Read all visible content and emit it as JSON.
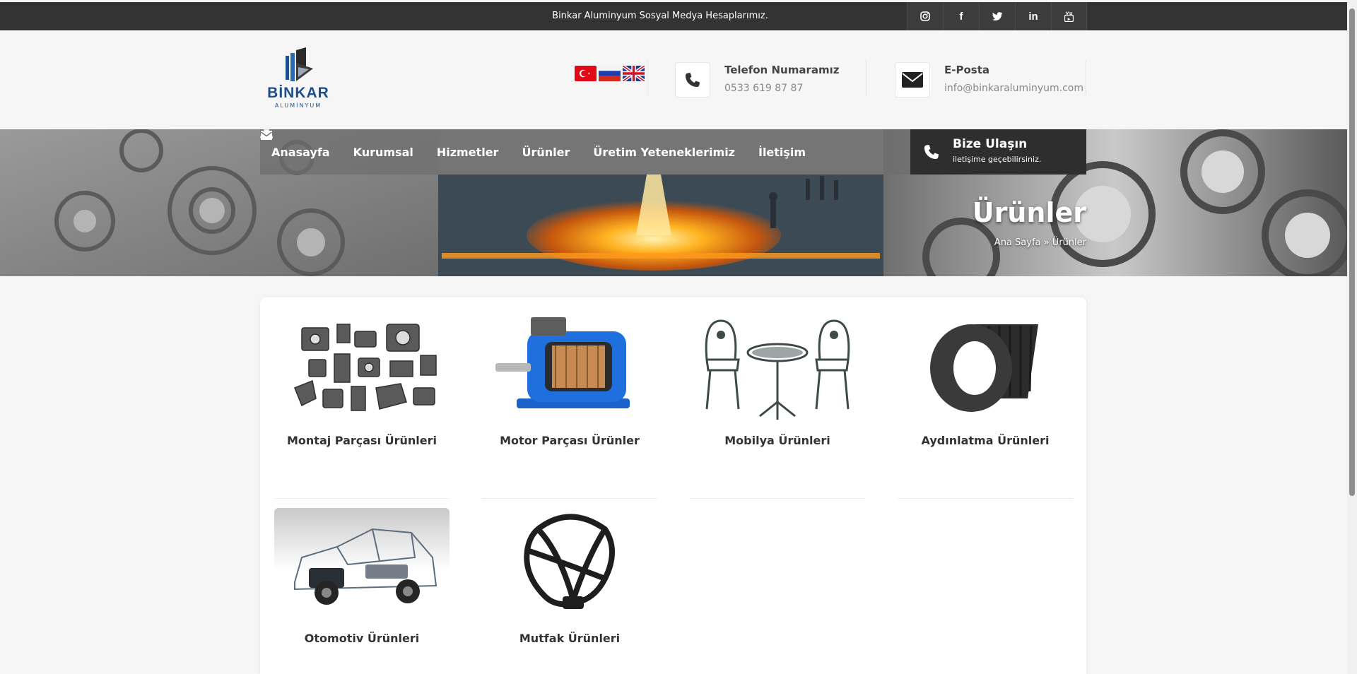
{
  "topbar": {
    "text": "Binkar Aluminyum Sosyal Medya Hesaplarımız.",
    "social": [
      {
        "icon": "instagram-icon",
        "glyph": "◎"
      },
      {
        "icon": "facebook-icon",
        "glyph": "f"
      },
      {
        "icon": "twitter-icon",
        "glyph": "t"
      },
      {
        "icon": "linkedin-icon",
        "glyph": "in"
      },
      {
        "icon": "youtube-icon",
        "glyph": "▶"
      }
    ]
  },
  "header": {
    "logo": {
      "word": "BİNKAR",
      "sub": "ALUMİNYUM"
    },
    "languages": [
      "tr-flag-icon",
      "ru-flag-icon",
      "uk-flag-icon"
    ],
    "phone": {
      "title": "Telefon Numaramız",
      "value": "0533 619 87 87"
    },
    "email": {
      "title": "E-Posta",
      "value": "info@binkaraluminyum.com"
    }
  },
  "nav": {
    "items": [
      {
        "label": "Anasayfa",
        "icon": "home-icon"
      },
      {
        "label": "Kurumsal",
        "icon": "briefcase-icon"
      },
      {
        "label": "Hizmetler",
        "icon": "list-icon"
      },
      {
        "label": "Ürünler",
        "icon": "eye-icon"
      },
      {
        "label": "Üretim Yeteneklerimiz",
        "icon": "users-icon"
      },
      {
        "label": "İletişim",
        "icon": "envelope-icon"
      }
    ],
    "cta": {
      "title": "Bize Ulaşın",
      "subtitle": "iletişime geçebilirsiniz."
    }
  },
  "hero": {
    "title": "Ürünler",
    "breadcrumb": "Ana Sayfa » Ürünler"
  },
  "products": [
    {
      "title": "Montaj Parçası Ürünleri",
      "image": "montaj-parts-image"
    },
    {
      "title": "Motor Parçası Ürünler",
      "image": "electric-motor-image"
    },
    {
      "title": "Mobilya Ürünleri",
      "image": "garden-furniture-image"
    },
    {
      "title": "Aydınlatma Ürünleri",
      "image": "lighting-heatsink-image"
    },
    {
      "title": "Otomotiv Ürünleri",
      "image": "car-xray-image"
    },
    {
      "title": "Mutfak Ürünleri",
      "image": "kitchen-part-image"
    }
  ],
  "colors": {
    "topbar": "#333333",
    "nav": "#6e6e6e",
    "cta": "#2e2e2e",
    "logo": "#1f4e8c"
  }
}
